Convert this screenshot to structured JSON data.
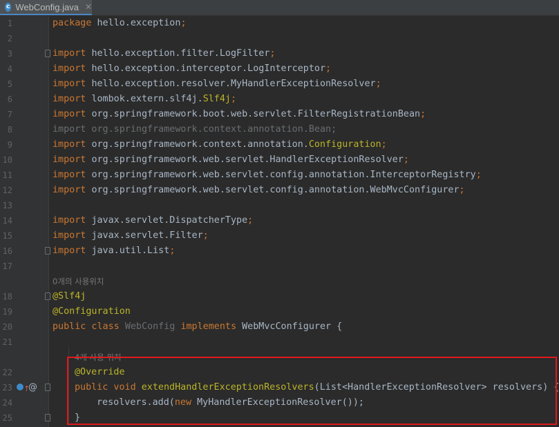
{
  "tab": {
    "label": "WebConfig.java",
    "icon": "c",
    "close": "✕"
  },
  "lines": [
    {
      "n": "1",
      "parts": [
        [
          "kw",
          "package "
        ],
        [
          "t",
          "hello.exception"
        ],
        [
          "kw",
          ";"
        ]
      ]
    },
    {
      "n": "2",
      "parts": []
    },
    {
      "n": "3",
      "parts": [
        [
          "kw",
          "import "
        ],
        [
          "t",
          "hello.exception.filter.LogFilter"
        ],
        [
          "kw",
          ";"
        ]
      ],
      "fold": true
    },
    {
      "n": "4",
      "parts": [
        [
          "kw",
          "import "
        ],
        [
          "t",
          "hello.exception.interceptor.LogInterceptor"
        ],
        [
          "kw",
          ";"
        ]
      ]
    },
    {
      "n": "5",
      "parts": [
        [
          "kw",
          "import "
        ],
        [
          "t",
          "hello.exception.resolver.MyHandlerExceptionResolver"
        ],
        [
          "kw",
          ";"
        ]
      ]
    },
    {
      "n": "6",
      "parts": [
        [
          "kw",
          "import "
        ],
        [
          "t",
          "lombok.extern.slf4j."
        ],
        [
          "an",
          "Slf4j"
        ],
        [
          "kw",
          ";"
        ]
      ]
    },
    {
      "n": "7",
      "parts": [
        [
          "kw",
          "import "
        ],
        [
          "t",
          "org.springframework.boot.web.servlet.FilterRegistrationBean"
        ],
        [
          "kw",
          ";"
        ]
      ]
    },
    {
      "n": "8",
      "parts": [
        [
          "dim",
          "import org.springframework.context.annotation.Bean;"
        ]
      ]
    },
    {
      "n": "9",
      "parts": [
        [
          "kw",
          "import "
        ],
        [
          "t",
          "org.springframework.context.annotation."
        ],
        [
          "an",
          "Configuration"
        ],
        [
          "kw",
          ";"
        ]
      ]
    },
    {
      "n": "10",
      "parts": [
        [
          "kw",
          "import "
        ],
        [
          "t",
          "org.springframework.web.servlet.HandlerExceptionResolver"
        ],
        [
          "kw",
          ";"
        ]
      ]
    },
    {
      "n": "11",
      "parts": [
        [
          "kw",
          "import "
        ],
        [
          "t",
          "org.springframework.web.servlet.config.annotation.InterceptorRegistry"
        ],
        [
          "kw",
          ";"
        ]
      ]
    },
    {
      "n": "12",
      "parts": [
        [
          "kw",
          "import "
        ],
        [
          "t",
          "org.springframework.web.servlet.config.annotation.WebMvcConfigurer"
        ],
        [
          "kw",
          ";"
        ]
      ]
    },
    {
      "n": "13",
      "parts": []
    },
    {
      "n": "14",
      "parts": [
        [
          "kw",
          "import "
        ],
        [
          "t",
          "javax.servlet.DispatcherType"
        ],
        [
          "kw",
          ";"
        ]
      ]
    },
    {
      "n": "15",
      "parts": [
        [
          "kw",
          "import "
        ],
        [
          "t",
          "javax.servlet.Filter"
        ],
        [
          "kw",
          ";"
        ]
      ]
    },
    {
      "n": "16",
      "parts": [
        [
          "kw",
          "import "
        ],
        [
          "t",
          "java.util.List"
        ],
        [
          "kw",
          ";"
        ]
      ],
      "fold": true
    },
    {
      "n": "17",
      "parts": []
    },
    {
      "n": "",
      "hint": "0개의 사용위치"
    },
    {
      "n": "18",
      "parts": [
        [
          "an",
          "@Slf4j"
        ]
      ],
      "fold": true
    },
    {
      "n": "19",
      "parts": [
        [
          "an",
          "@Configuration"
        ]
      ]
    },
    {
      "n": "20",
      "parts": [
        [
          "kw",
          "public class "
        ],
        [
          "dim",
          "WebConfig "
        ],
        [
          "kw",
          "implements "
        ],
        [
          "t",
          "WebMvcConfigurer {"
        ]
      ]
    },
    {
      "n": "21",
      "parts": []
    },
    {
      "n": "",
      "hint": "4개 사용 위치",
      "indent": 1
    },
    {
      "n": "22",
      "parts": [
        [
          "an",
          "@Override"
        ]
      ],
      "indent": 1
    },
    {
      "n": "23",
      "parts": [
        [
          "kw",
          "public void "
        ],
        [
          "an",
          "extendHandlerExceptionResolvers"
        ],
        [
          "t",
          "(List<HandlerExceptionResolver> resolvers) {"
        ]
      ],
      "indent": 1,
      "fold": true,
      "gutterIcons": true
    },
    {
      "n": "24",
      "parts": [
        [
          "t",
          "resolvers.add("
        ],
        [
          "kw",
          "new "
        ],
        [
          "t",
          "MyHandlerExceptionResolver());"
        ]
      ],
      "indent": 2
    },
    {
      "n": "25",
      "parts": [
        [
          "t",
          "}"
        ]
      ],
      "indent": 1,
      "fold": true
    }
  ],
  "gutter_icons": {
    "override": "override-icon",
    "at": "@"
  },
  "colors": {
    "keyword": "#cc7832",
    "annotation": "#bbb529",
    "text": "#a9b7c6",
    "highlight_box": "#e0191c"
  }
}
